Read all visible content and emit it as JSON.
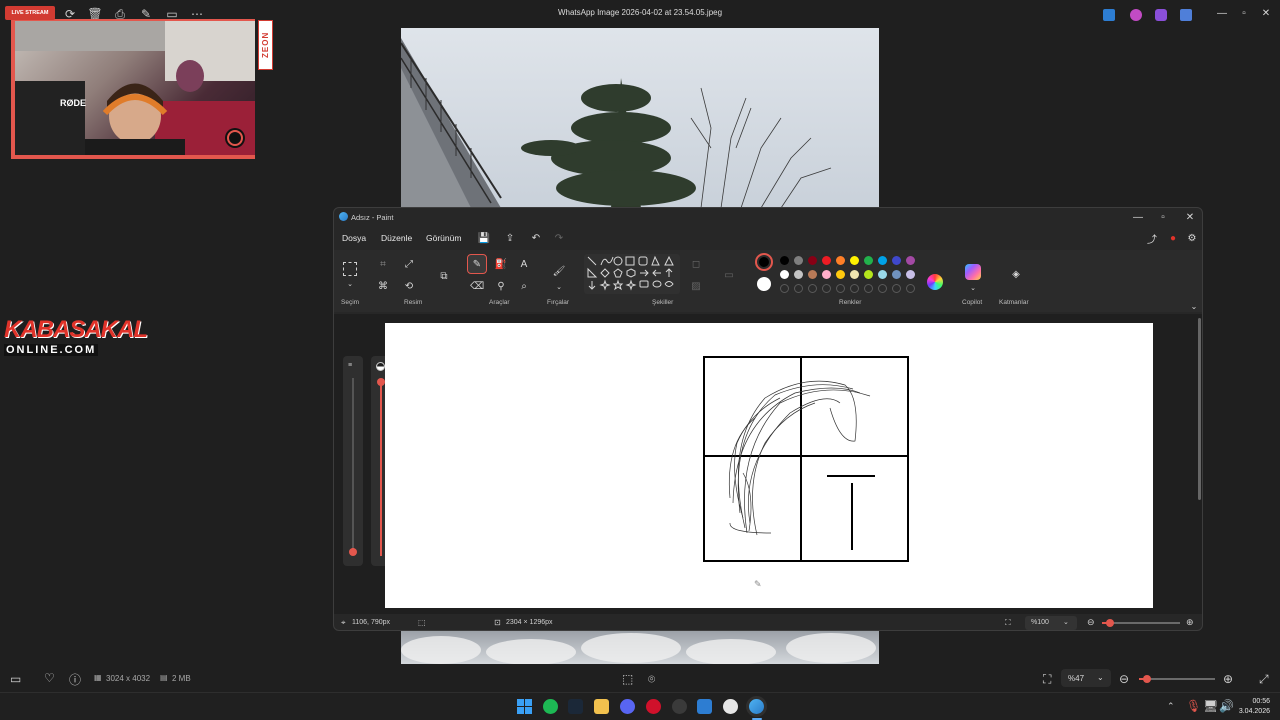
{
  "viewer": {
    "title": "WhatsApp Image 2026-04-02 at 23.54.05.jpeg",
    "dimensions": "3024 x 4032",
    "file_size": "2 MB",
    "zoom": "%47",
    "zoom_level": 0.1
  },
  "overlay": {
    "live_badge": "LIVE STREAM",
    "zeon_logo": "ZEON",
    "brand_line1": "KABASAKAL",
    "brand_line2": "ONLINE.COM"
  },
  "paint": {
    "title": "Adsız - Paint",
    "menu": [
      "Dosya",
      "Düzenle",
      "Görünüm"
    ],
    "groups": {
      "selection": "Seçim",
      "image": "Resim",
      "tools": "Araçlar",
      "brushes": "Fırçalar",
      "shapes": "Şekiller",
      "colors": "Renkler",
      "copilot": "Copilot",
      "layers": "Katmanlar"
    },
    "palette_row1": [
      "#000000",
      "#7f7f7f",
      "#880015",
      "#ed1c24",
      "#ff7f27",
      "#fff200",
      "#22b14c",
      "#00a2e8",
      "#3f48cc",
      "#a349a4"
    ],
    "palette_row2": [
      "#ffffff",
      "#c3c3c3",
      "#b97a57",
      "#ffaec9",
      "#ffc90e",
      "#efe4b0",
      "#b5e61d",
      "#99d9ea",
      "#7092be",
      "#c8bfe7"
    ],
    "primary_color": "#000000",
    "secondary_color": "#ffffff",
    "status": {
      "cursor_pos": "1106, 790px",
      "canvas_size": "2304 × 1296px",
      "zoom": "%100",
      "zoom_level": 0.1
    }
  },
  "taskbar": {
    "time": "00:56",
    "date": "3.04.2026"
  }
}
